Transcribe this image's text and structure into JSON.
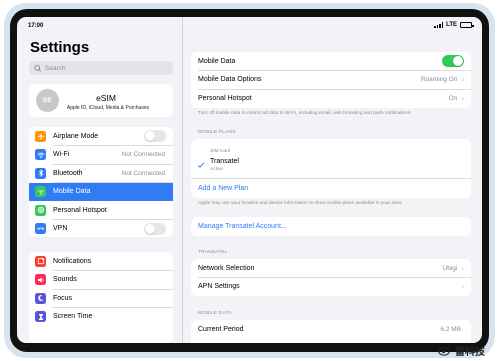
{
  "status_bar": {
    "time": "17:00",
    "network": "LTE",
    "battery": "100%"
  },
  "sidebar": {
    "title": "Settings",
    "search_placeholder": "Search",
    "profile": {
      "initials": "DE",
      "name": "eSIM",
      "subtitle": "Apple ID, iCloud, Media & Purchases"
    },
    "group1": [
      {
        "label": "Airplane Mode",
        "icon": "airplane-icon",
        "color": "#ff9500",
        "control": "toggle-off"
      },
      {
        "label": "Wi-Fi",
        "icon": "wifi-icon",
        "color": "#2f7cf6",
        "value": "Not Connected"
      },
      {
        "label": "Bluetooth",
        "icon": "bluetooth-icon",
        "color": "#2f7cf6",
        "value": "Not Connected"
      },
      {
        "label": "Mobile Data",
        "icon": "antenna-icon",
        "color": "#34c759",
        "selected": true
      },
      {
        "label": "Personal Hotspot",
        "icon": "hotspot-icon",
        "color": "#34c759"
      },
      {
        "label": "VPN",
        "icon": "vpn-icon",
        "color": "#2f7cf6",
        "icon_text": "VPN",
        "control": "toggle-off"
      }
    ],
    "group2": [
      {
        "label": "Notifications",
        "icon": "notifications-icon",
        "color": "#ff3b30"
      },
      {
        "label": "Sounds",
        "icon": "speaker-icon",
        "color": "#ff2d55"
      },
      {
        "label": "Focus",
        "icon": "moon-icon",
        "color": "#5856d6"
      },
      {
        "label": "Screen Time",
        "icon": "hourglass-icon",
        "color": "#5856d6"
      }
    ]
  },
  "main": {
    "top_group": [
      {
        "label": "Mobile Data",
        "control": "toggle-on"
      },
      {
        "label": "Mobile Data Options",
        "value": "Roaming On"
      },
      {
        "label": "Personal Hotspot",
        "value": "On"
      }
    ],
    "top_note": "Turn off mobile data to restrict all data to Wi-Fi, including email, web browsing and push notifications.",
    "plans_header": "MOBILE PLANS",
    "plans_subheader": "SIM Card",
    "plan_name": "Transatel",
    "plan_status": "Active",
    "add_plan": "Add a New Plan",
    "plans_note": "Apple may use your location and device information to show mobile plans available in your area.",
    "manage_account": "Manage Transatel Account...",
    "transatel_header": "TRANSATEL",
    "transatel_group": [
      {
        "label": "Network Selection",
        "value": "Ubigi"
      },
      {
        "label": "APN Settings",
        "value": ""
      }
    ],
    "mobile_data_header": "MOBILE DATA",
    "current_period_label": "Current Period",
    "current_period_value": "6,2 MB"
  },
  "watermark": "雷科技"
}
